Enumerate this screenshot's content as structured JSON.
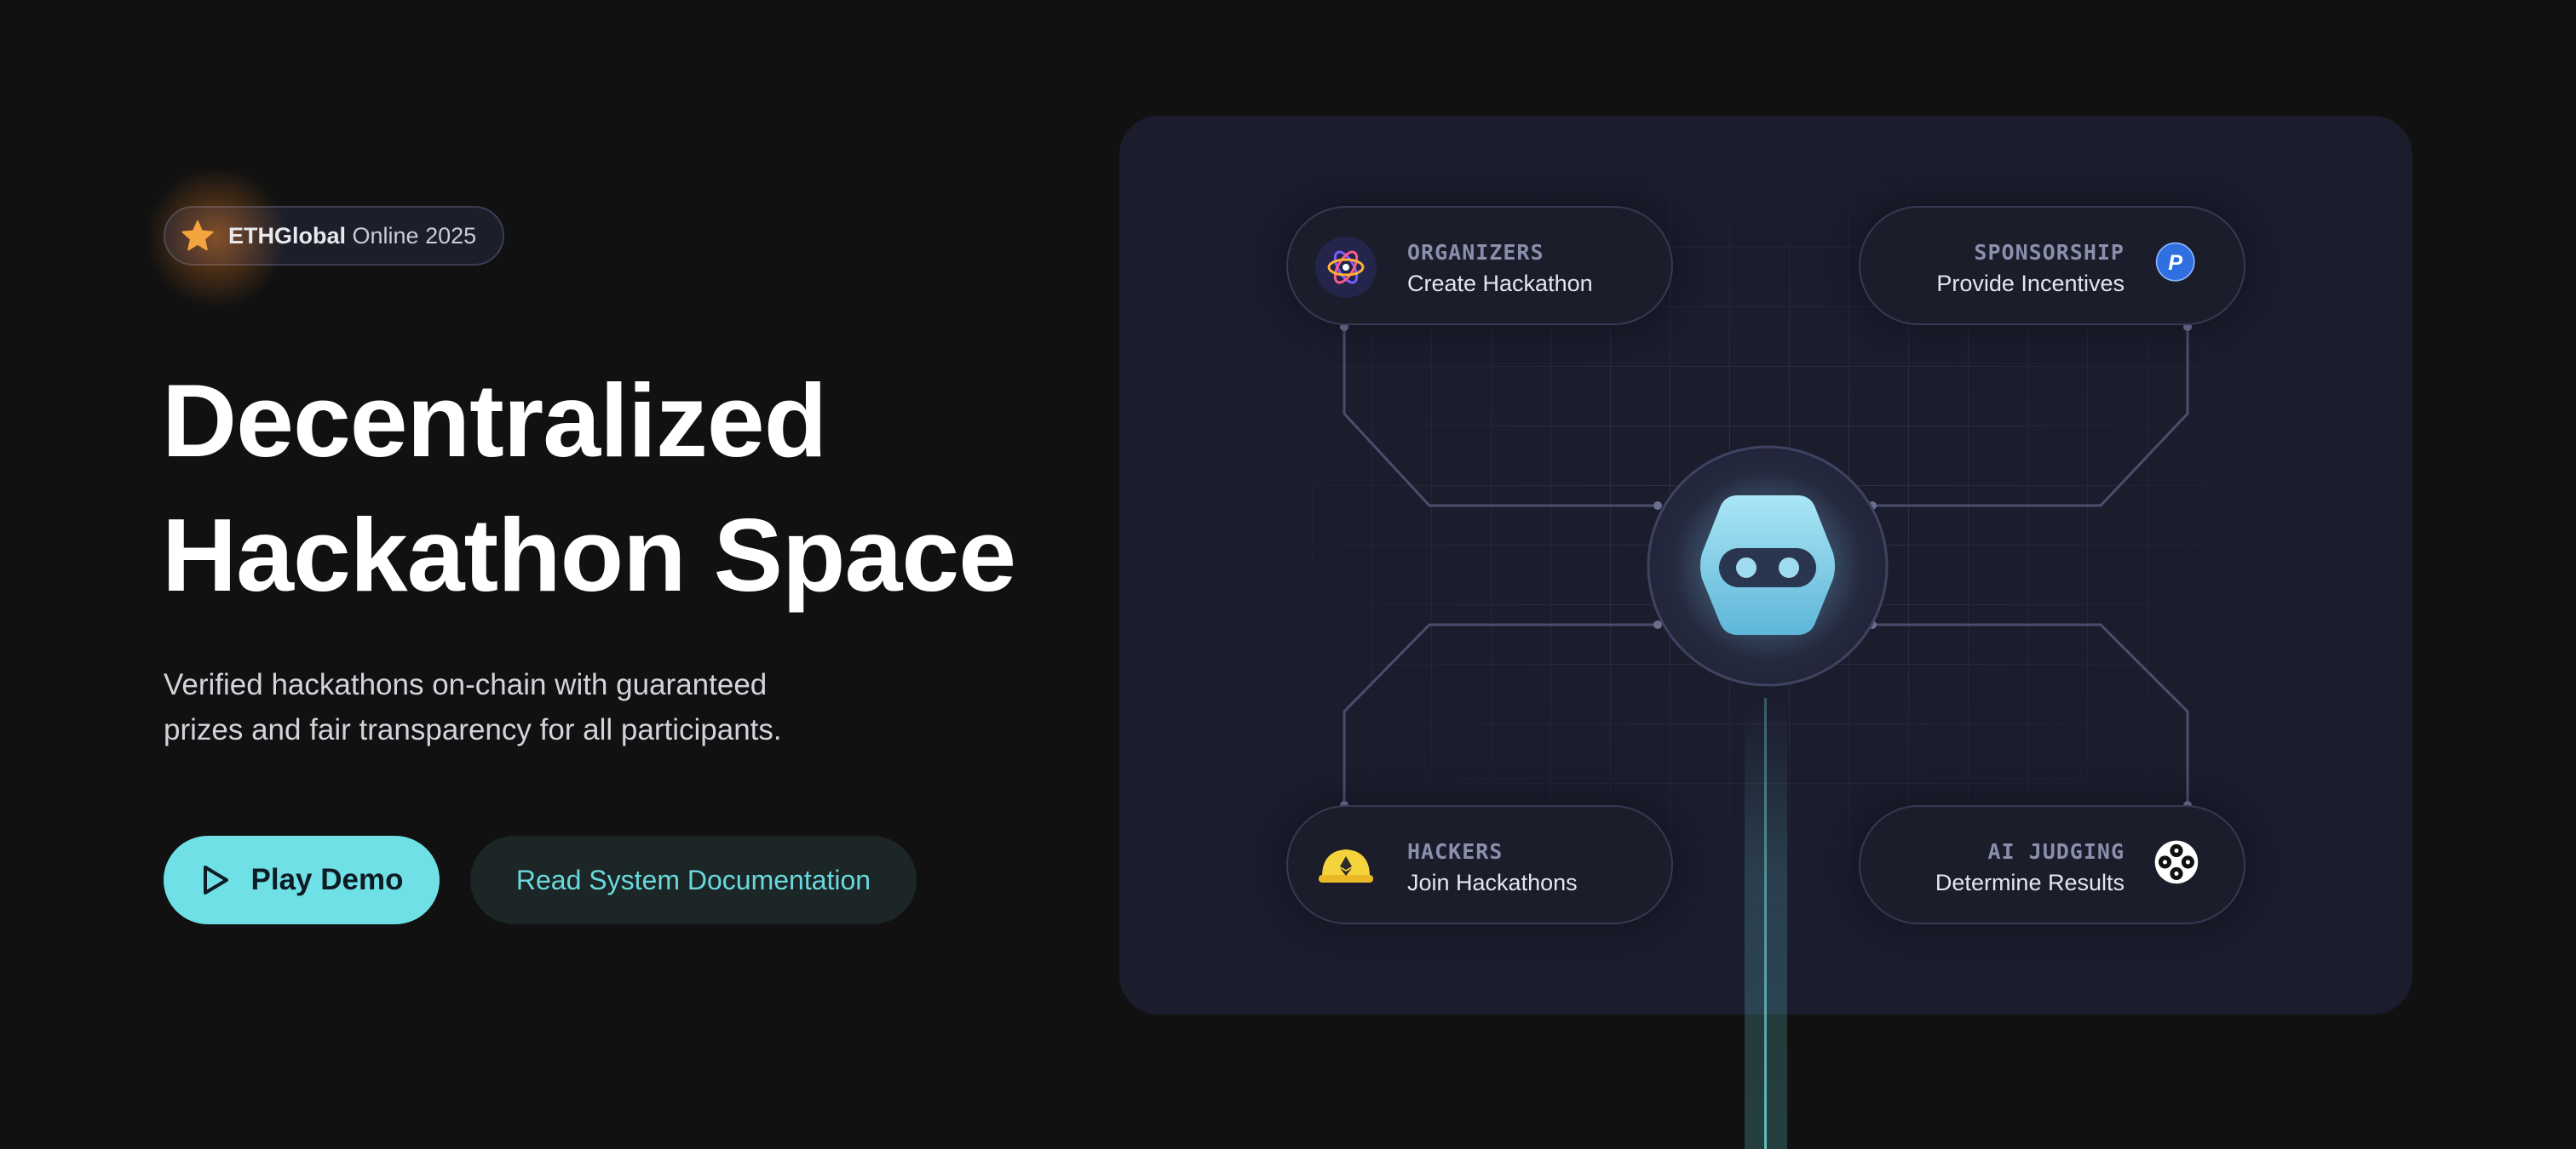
{
  "badge": {
    "brand": "ETHGlobal",
    "event": "Online 2025",
    "icon": "star-icon"
  },
  "hero": {
    "title_line1": "Decentralized",
    "title_line2": "Hackathon Space",
    "subtitle_line1": "Verified hackathons on-chain with guaranteed",
    "subtitle_line2": "prizes and fair transparency for all participants."
  },
  "actions": {
    "play_demo": "Play Demo",
    "read_docs": "Read System Documentation"
  },
  "diagram": {
    "organizers": {
      "caption": "ORGANIZERS",
      "desc": "Create Hackathon",
      "icon": "organizers-logo-icon"
    },
    "sponsorship": {
      "caption": "SPONSORSHIP",
      "desc": "Provide Incentives",
      "icon": "paypal-icon"
    },
    "hackers": {
      "caption": "HACKERS",
      "desc": "Join Hackathons",
      "icon": "hard-hat-icon"
    },
    "ai_judging": {
      "caption": "AI JUDGING",
      "desc": "Determine Results",
      "icon": "ai-flower-icon"
    },
    "hub_icon": "robot-head-icon"
  },
  "colors": {
    "background": "#111111",
    "accent": "#6ee0e6",
    "panel": "#1b1c2c",
    "secondary_button": "#1c2626"
  }
}
